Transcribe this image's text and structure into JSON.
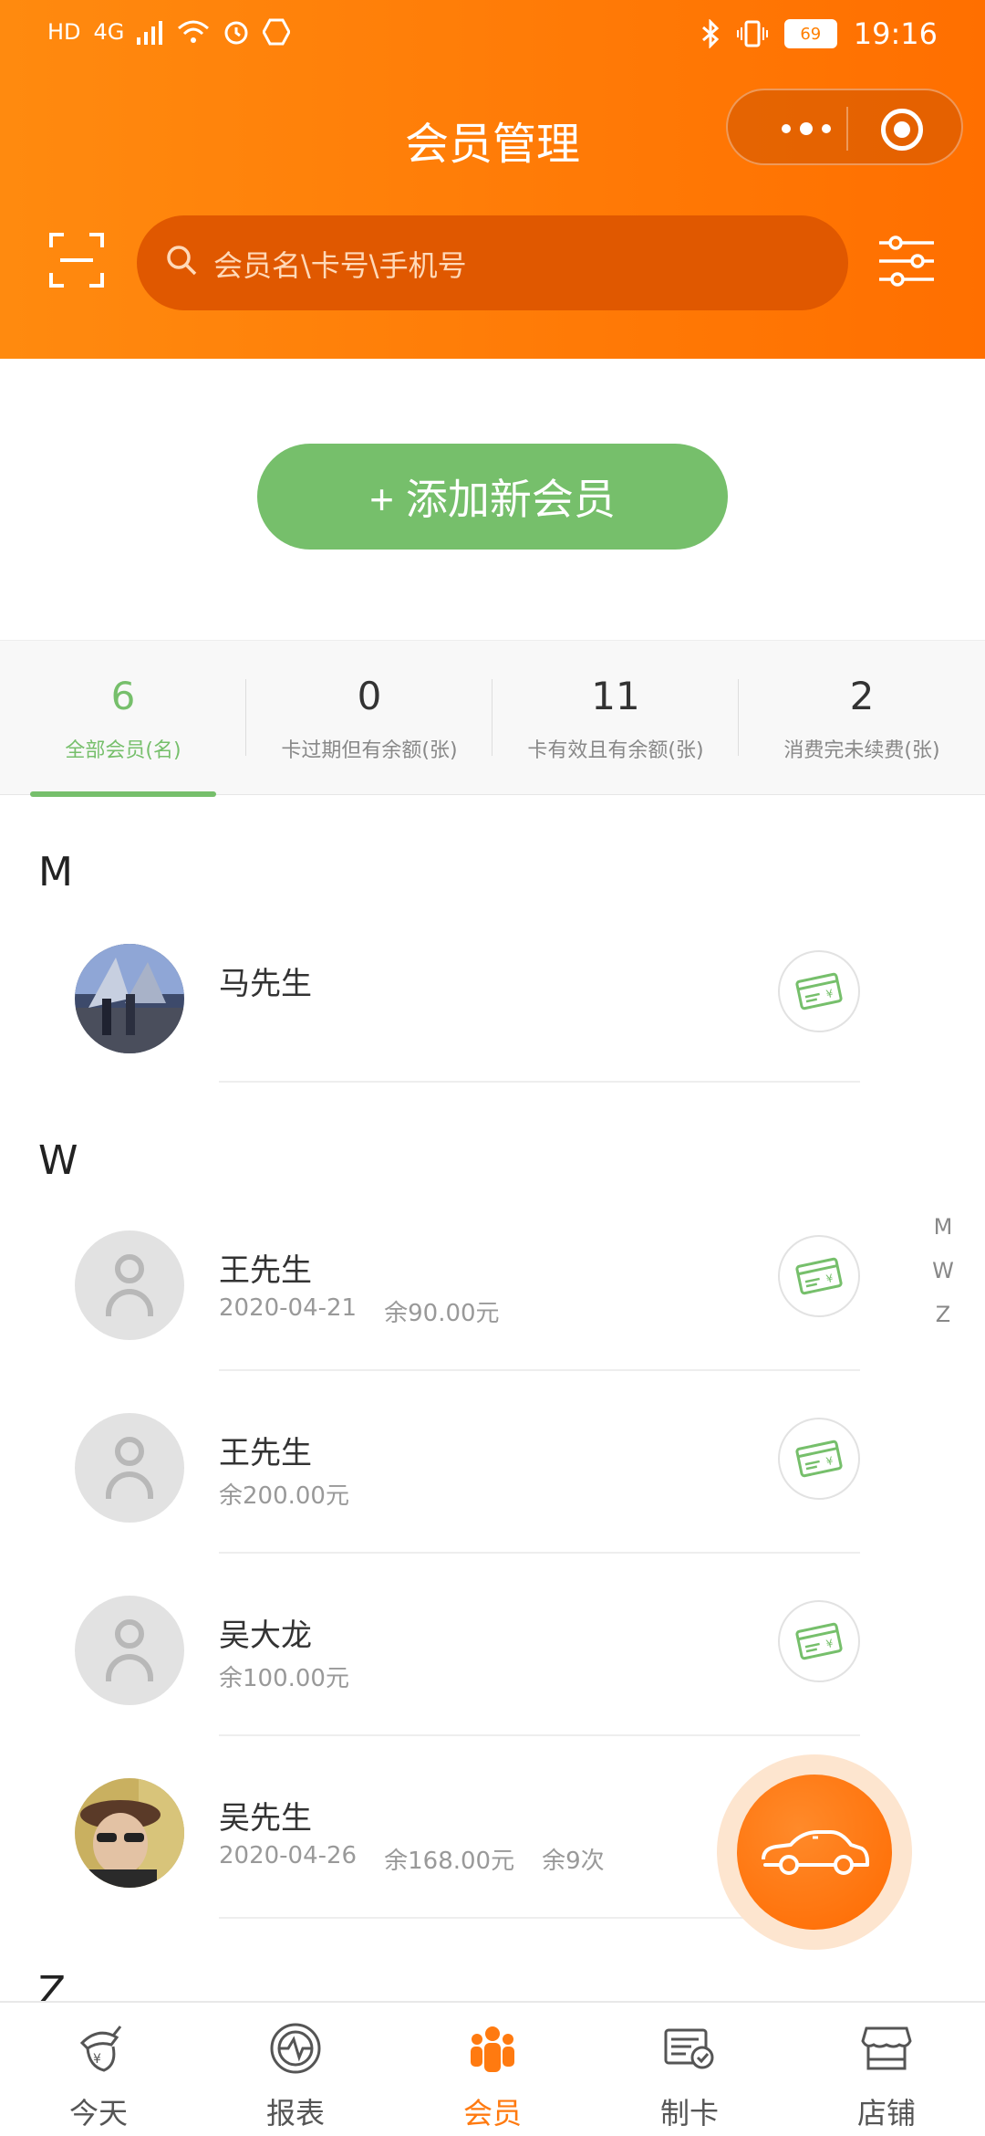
{
  "status_bar": {
    "left_icons": [
      "hd-icon",
      "signal-4g-icon",
      "wifi-icon",
      "alarm-icon",
      "nfc-icon"
    ],
    "hd": "HD",
    "network": "4G",
    "battery": "69",
    "time": "19:16"
  },
  "header": {
    "title": "会员管理",
    "search_placeholder": "会员名\\卡号\\手机号",
    "accent": "#ff7a0a"
  },
  "add_member": {
    "label": "+ 添加新会员",
    "color": "#76bf6b"
  },
  "stats": [
    {
      "value": "6",
      "label": "全部会员(名)",
      "active": true
    },
    {
      "value": "0",
      "label": "卡过期但有余额(张)",
      "active": false
    },
    {
      "value": "11",
      "label": "卡有效且有余额(张)",
      "active": false
    },
    {
      "value": "2",
      "label": "消费完未续费(张)",
      "active": false
    }
  ],
  "groups": [
    {
      "letter": "M",
      "members": [
        {
          "name": "马先生",
          "date": "",
          "balance": "",
          "count": "",
          "avatar": "photo"
        }
      ]
    },
    {
      "letter": "W",
      "members": [
        {
          "name": "王先生",
          "date": "2020-04-21",
          "balance": "余90.00元",
          "count": "",
          "avatar": "default"
        },
        {
          "name": "王先生",
          "date": "",
          "balance": "余200.00元",
          "count": "",
          "avatar": "default"
        },
        {
          "name": "吴大龙",
          "date": "",
          "balance": "余100.00元",
          "count": "",
          "avatar": "default"
        },
        {
          "name": "吴先生",
          "date": "2020-04-26",
          "balance": "余168.00元",
          "count": "余9次",
          "avatar": "photo"
        }
      ]
    },
    {
      "letter": "Z",
      "members": []
    }
  ],
  "index_letters": [
    "M",
    "W",
    "Z"
  ],
  "nav": [
    {
      "label": "今天",
      "icon": "acorn-icon",
      "active": false
    },
    {
      "label": "报表",
      "icon": "report-icon",
      "active": false
    },
    {
      "label": "会员",
      "icon": "members-icon",
      "active": true
    },
    {
      "label": "制卡",
      "icon": "card-make-icon",
      "active": false
    },
    {
      "label": "店铺",
      "icon": "store-icon",
      "active": false
    }
  ]
}
